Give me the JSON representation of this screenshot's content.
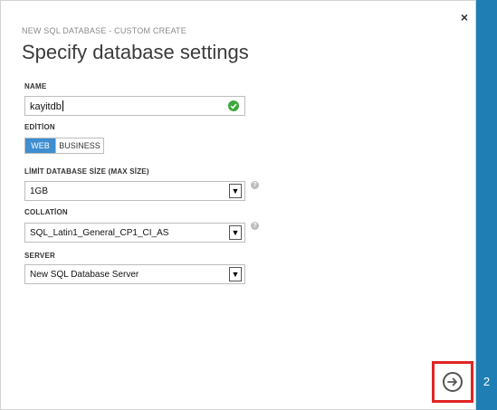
{
  "dialog": {
    "header": "NEW SQL DATABASE - CUSTOM CREATE",
    "title": "Specify database settings",
    "close_label": "×",
    "step_number": "2"
  },
  "fields": {
    "name": {
      "label": "NAME",
      "value": "kayitdb"
    },
    "edition": {
      "label": "EDİTİON",
      "options": [
        "WEB",
        "BUSINESS"
      ],
      "selected": "WEB"
    },
    "size": {
      "label": "LİMİT DATABASE SİZE (MAX SİZE)",
      "value": "1GB"
    },
    "collation": {
      "label": "COLLATİON",
      "value": "SQL_Latin1_General_CP1_CI_AS"
    },
    "server": {
      "label": "SERVER",
      "value": "New SQL Database Server"
    }
  },
  "help_glyph": "?",
  "select_arrow_glyph": "▼",
  "colors": {
    "accent": "#1f7fb4",
    "toggle_active": "#3e8ed0",
    "valid": "#3aa83a",
    "highlight": "#e02424"
  },
  "icons": [
    "close-icon",
    "check-icon",
    "help-icon",
    "chevron-down-icon",
    "arrow-right-icon"
  ]
}
